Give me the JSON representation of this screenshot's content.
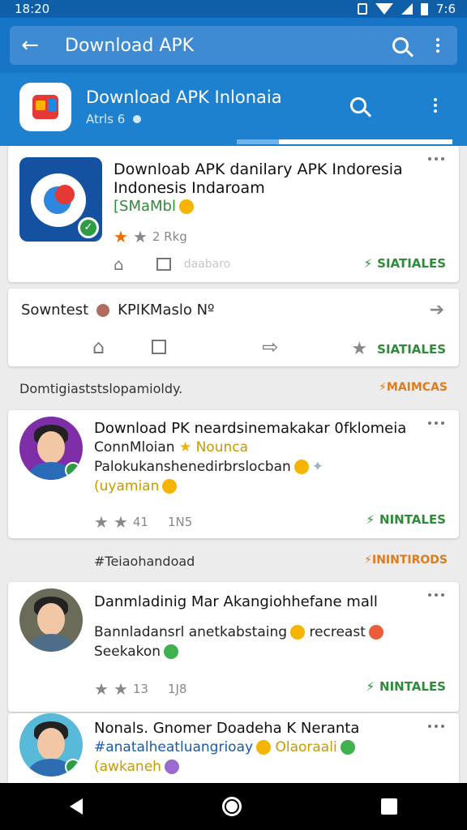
{
  "status_bar": {
    "time": "18:20",
    "right_text": "7:6"
  },
  "top_bar": {
    "title": "Download APK",
    "icons": [
      "back-arrow-icon",
      "search-icon",
      "more-vert-icon"
    ]
  },
  "app_header": {
    "title": "Download APK Inlonaia",
    "subtitle": "Atrls 6",
    "icons": [
      "search-icon",
      "more-vert-icon"
    ]
  },
  "card1": {
    "title_line1": "Downloab APK danilary APK Indoresia",
    "title_line2": "Indonesis Indaroam",
    "green_text": "[SMaMbl",
    "rating": "2 Rkg",
    "faint_text": "daabaro",
    "action": "SIATIALES"
  },
  "card2": {
    "text": "Sowntest",
    "text2": "KPIKMaslo Nº",
    "action": "SIATIALES"
  },
  "section1": {
    "left": "Domtigiaststslopamioldy.",
    "right": "MAIMCAS"
  },
  "post1": {
    "title": "Download PK neardsinemakakar 0fklomeia",
    "line2": "ConnMloian",
    "line2_gold": "Nounca",
    "line3": "Palokukanshenedirbrslocban",
    "line4": "(uyamian",
    "stats_count": "41",
    "stats_extra": "1N5",
    "action": "NINTALES"
  },
  "section2": {
    "left": "Teiaohandoad",
    "right": "ININTIRODS"
  },
  "post2": {
    "title": "Danmladinig Mar Akangiohhefane mall",
    "line2": "Bannladansrl anetkabstaing",
    "line2b": "recreast",
    "line3": "Seekakon",
    "stats_count": "13",
    "stats_extra": "1J8",
    "action": "NINTALES"
  },
  "post3": {
    "title": "Nonals. Gnomer Doadeha K Neranta",
    "line2": "#anatalheatluangrioay",
    "line2b": "Olaoraali",
    "line3": "(awkaneh"
  },
  "colors": {
    "status_bar": "#0f5ea8",
    "top_bar": "#1775c7",
    "header": "#1e81d0",
    "green": "#2e8b3a",
    "orange": "#e07b1a"
  }
}
